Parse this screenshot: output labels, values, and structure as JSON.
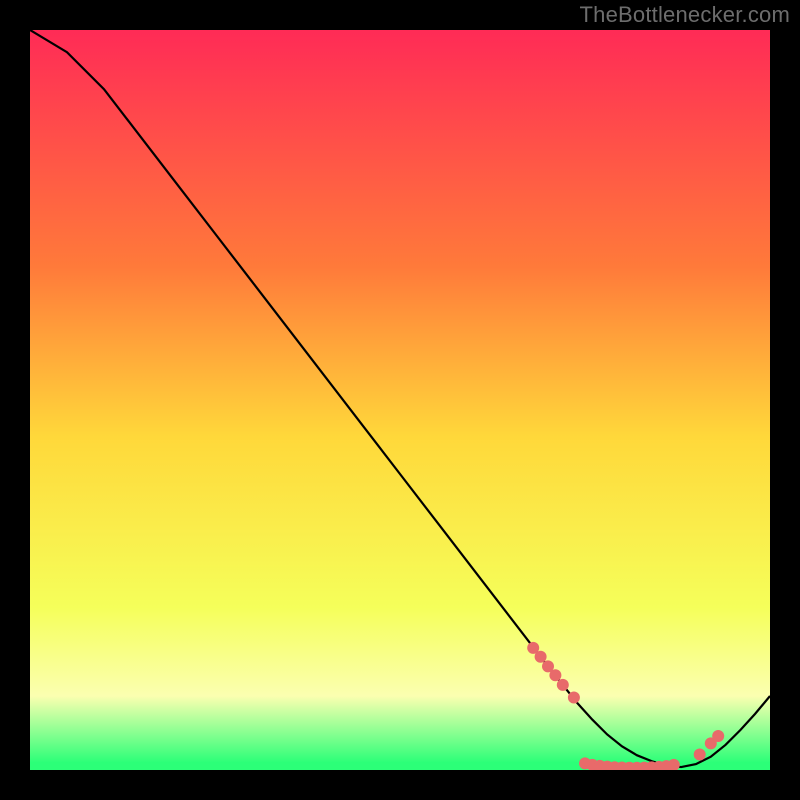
{
  "watermark": "TheBottlenecker.com",
  "colors": {
    "bg_black": "#000000",
    "grad_top": "#ff2b56",
    "grad_mid_upper": "#ff7a3a",
    "grad_mid": "#ffd83a",
    "grad_mid_lower": "#f5ff5a",
    "grad_pale": "#fbffb0",
    "grad_green": "#2cff78",
    "line": "#000000",
    "marker": "#e86a6a"
  },
  "chart_data": {
    "type": "line",
    "title": "",
    "xlabel": "",
    "ylabel": "",
    "xlim": [
      0,
      100
    ],
    "ylim": [
      0,
      100
    ],
    "series": [
      {
        "name": "curve",
        "x": [
          0,
          5,
          10,
          15,
          20,
          25,
          30,
          35,
          40,
          45,
          50,
          55,
          60,
          65,
          70,
          72,
          74,
          76,
          78,
          80,
          82,
          84,
          86,
          88,
          90,
          92,
          94,
          96,
          98,
          100
        ],
        "y": [
          100,
          97,
          92,
          85.5,
          79,
          72.5,
          66,
          59.5,
          53,
          46.5,
          40,
          33.5,
          27,
          20.5,
          14,
          11.5,
          9,
          6.8,
          4.8,
          3.2,
          2.0,
          1.2,
          0.6,
          0.4,
          0.8,
          1.8,
          3.4,
          5.4,
          7.6,
          10
        ]
      }
    ],
    "markers": [
      {
        "x": 68,
        "y": 16.5
      },
      {
        "x": 69,
        "y": 15.3
      },
      {
        "x": 70,
        "y": 14.0
      },
      {
        "x": 71,
        "y": 12.8
      },
      {
        "x": 72,
        "y": 11.5
      },
      {
        "x": 73.5,
        "y": 9.8
      },
      {
        "x": 75,
        "y": 0.9
      },
      {
        "x": 76,
        "y": 0.7
      },
      {
        "x": 77,
        "y": 0.55
      },
      {
        "x": 78,
        "y": 0.45
      },
      {
        "x": 79,
        "y": 0.38
      },
      {
        "x": 80,
        "y": 0.33
      },
      {
        "x": 81,
        "y": 0.3
      },
      {
        "x": 82,
        "y": 0.3
      },
      {
        "x": 83,
        "y": 0.32
      },
      {
        "x": 84,
        "y": 0.36
      },
      {
        "x": 85,
        "y": 0.42
      },
      {
        "x": 86,
        "y": 0.52
      },
      {
        "x": 87,
        "y": 0.7
      },
      {
        "x": 90.5,
        "y": 2.1
      },
      {
        "x": 92,
        "y": 3.6
      },
      {
        "x": 93,
        "y": 4.6
      }
    ]
  }
}
